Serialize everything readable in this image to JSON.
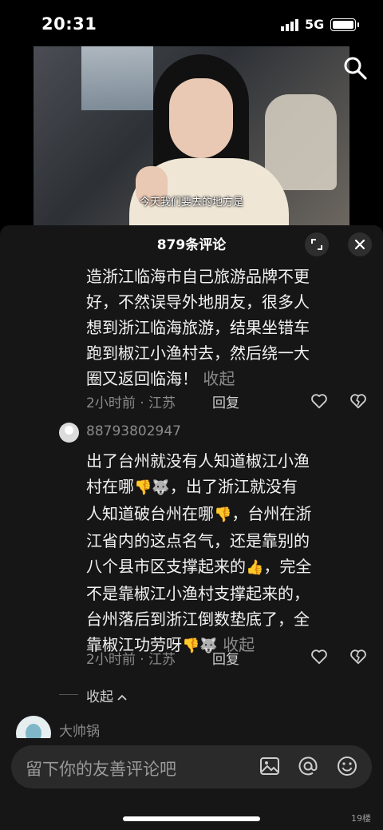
{
  "status_bar": {
    "time": "20:31",
    "network": "5G"
  },
  "video": {
    "caption": "今天我们要去的地方是"
  },
  "comments_sheet": {
    "title": "879条评论",
    "comment1": {
      "lines": [
        "造浙江临海市自己旅游品牌不更",
        "好，不然误导外地朋友，很多人",
        "想到浙江临海旅游，结果坐错车",
        "跑到椒江小渔村去，然后绕一大"
      ],
      "last_line": "圈又返回临海！",
      "collapse": "收起",
      "meta": "2小时前 · 江苏",
      "reply": "回复"
    },
    "comment2": {
      "username": "88793802947",
      "l1": "出了台州就没有人知道椒江小渔",
      "l2a": "村在哪",
      "l2b": "，出了浙江就没有",
      "l3a": "人知道破台州在哪",
      "l3b": "，台州在浙",
      "l4": "江省内的这点名气，还是靠别的",
      "l5a": "八个县市区支撑起来的",
      "l5b": "，完全",
      "l6": "不是靠椒江小渔村支撑起来的，",
      "l7": "台州落后到浙江倒数垫底了，全",
      "l8": "靠椒江功劳呀",
      "collapse": "收起",
      "meta": "2小时前 · 江苏",
      "reply": "回复"
    },
    "fold": "收起",
    "next_username": "大帅锅"
  },
  "input": {
    "placeholder": "留下你的友善评论吧"
  },
  "watermark": "19楼"
}
